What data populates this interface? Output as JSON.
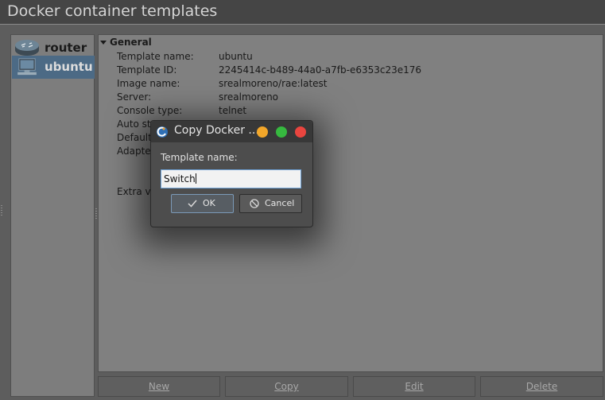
{
  "window": {
    "title": "Docker container templates"
  },
  "templates": [
    {
      "name": "router",
      "icon": "router-icon",
      "selected": false
    },
    {
      "name": "ubuntu",
      "icon": "computer-icon",
      "selected": true
    }
  ],
  "properties": {
    "section": "General",
    "rows": [
      {
        "key": "Template name:",
        "value": "ubuntu"
      },
      {
        "key": "Template ID:",
        "value": "2245414c-b489-44a0-a7fb-e6353c23e176"
      },
      {
        "key": "Image name:",
        "value": "srealmoreno/rae:latest"
      },
      {
        "key": "Server:",
        "value": "srealmoreno"
      },
      {
        "key": "Console type:",
        "value": "telnet"
      },
      {
        "key": "Auto st",
        "value": ""
      },
      {
        "key": "Default",
        "value": ""
      },
      {
        "key": "Adapter",
        "value": ""
      },
      {
        "key": "Extra vo",
        "value": ""
      }
    ]
  },
  "actions": {
    "new": "New",
    "copy": "Copy",
    "edit": "Edit",
    "delete": "Delete"
  },
  "dialog": {
    "title": "Copy Docker ...",
    "label": "Template name:",
    "input_value": "Switch",
    "ok": "OK",
    "cancel": "Cancel"
  },
  "colors": {
    "selection": "#4c6a85",
    "minimize": "#f3a72a",
    "maximize": "#36b93f",
    "close": "#e9453f",
    "input_focus": "#6fa3d8"
  }
}
